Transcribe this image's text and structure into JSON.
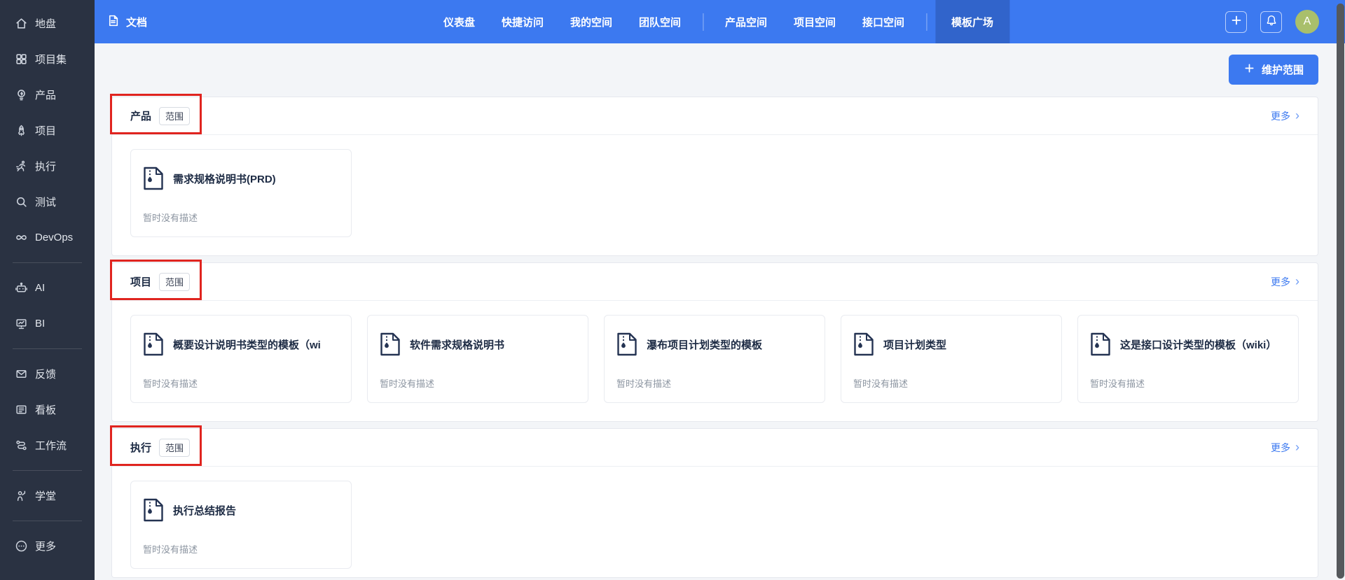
{
  "colors": {
    "accent": "#3c79f0",
    "topbar": "#3c79f0",
    "topbar_active": "#3164cb",
    "sidebar_bg": "#2a3242",
    "annotation_red": "#e0241f",
    "avatar_bg": "#a9bf6b",
    "content_bg": "#f3f5f8",
    "title_text": "#1d2b44",
    "desc_text": "#8c95a1"
  },
  "topbar": {
    "app": {
      "label": "文档",
      "icon": "document-icon"
    },
    "nav": [
      {
        "key": "dashboard",
        "label": "仪表盘"
      },
      {
        "key": "quick-access",
        "label": "快捷访问"
      },
      {
        "key": "my-space",
        "label": "我的空间"
      },
      {
        "key": "team-space",
        "label": "团队空间"
      },
      {
        "divider": true
      },
      {
        "key": "product-space",
        "label": "产品空间"
      },
      {
        "key": "project-space",
        "label": "项目空间"
      },
      {
        "key": "api-space",
        "label": "接口空间"
      },
      {
        "divider": true
      },
      {
        "key": "template-market",
        "label": "模板广场",
        "active": true
      }
    ],
    "actions": {
      "add_icon": "plus-icon",
      "bell_icon": "bell-icon",
      "avatar_text": "A"
    }
  },
  "sidebar": {
    "items": [
      {
        "key": "home",
        "label": "地盘",
        "icon": "home-icon"
      },
      {
        "key": "program",
        "label": "项目集",
        "icon": "grid-icon"
      },
      {
        "key": "product",
        "label": "产品",
        "icon": "lightbulb-icon"
      },
      {
        "key": "project",
        "label": "项目",
        "icon": "rocket-icon"
      },
      {
        "key": "execution",
        "label": "执行",
        "icon": "runner-icon"
      },
      {
        "key": "test",
        "label": "测试",
        "icon": "magnifier-icon"
      },
      {
        "key": "devops",
        "label": "DevOps",
        "icon": "infinity-icon"
      },
      {
        "divider": true
      },
      {
        "key": "ai",
        "label": "AI",
        "icon": "robot-icon"
      },
      {
        "key": "bi",
        "label": "BI",
        "icon": "presentation-icon"
      },
      {
        "divider": true
      },
      {
        "key": "feedback",
        "label": "反馈",
        "icon": "mail-icon"
      },
      {
        "key": "kanban",
        "label": "看板",
        "icon": "kanban-icon"
      },
      {
        "key": "workflow",
        "label": "工作流",
        "icon": "workflow-icon"
      },
      {
        "divider": true
      },
      {
        "key": "school",
        "label": "学堂",
        "icon": "teacher-icon"
      },
      {
        "divider": true
      },
      {
        "key": "more",
        "label": "更多",
        "icon": "more-icon"
      }
    ]
  },
  "main": {
    "maintain_button": {
      "label": "维护范围",
      "icon": "plus-icon"
    },
    "sections": [
      {
        "key": "product",
        "title": "产品",
        "badge": "范围",
        "more_label": "更多",
        "cards": [
          {
            "icon": "template-doc-icon",
            "title": "需求规格说明书(PRD)",
            "desc": "暂时没有描述"
          }
        ]
      },
      {
        "key": "project",
        "title": "项目",
        "badge": "范围",
        "more_label": "更多",
        "cards": [
          {
            "icon": "template-doc-icon",
            "title": "概要设计说明书类型的模板（wi",
            "desc": "暂时没有描述"
          },
          {
            "icon": "template-doc-icon",
            "title": "软件需求规格说明书",
            "desc": "暂时没有描述"
          },
          {
            "icon": "template-doc-icon",
            "title": "瀑布项目计划类型的模板",
            "desc": "暂时没有描述"
          },
          {
            "icon": "template-doc-icon",
            "title": "项目计划类型",
            "desc": "暂时没有描述"
          },
          {
            "icon": "template-doc-icon",
            "title": "这是接口设计类型的模板（wiki）",
            "desc": "暂时没有描述"
          }
        ]
      },
      {
        "key": "execution",
        "title": "执行",
        "badge": "范围",
        "more_label": "更多",
        "cards": [
          {
            "icon": "template-doc-icon",
            "title": "执行总结报告",
            "desc": "暂时没有描述"
          }
        ]
      }
    ]
  }
}
